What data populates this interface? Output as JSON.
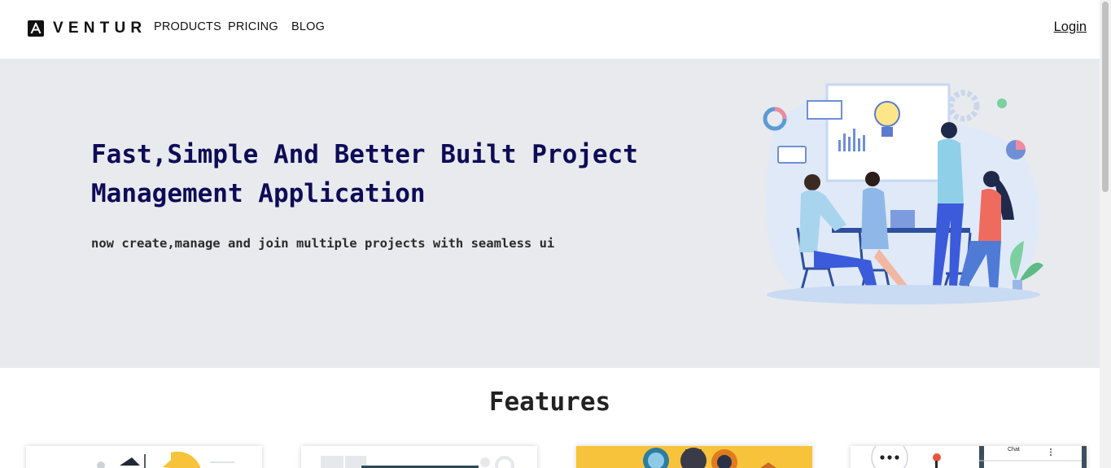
{
  "header": {
    "logo_text": "VENTUR",
    "logo_mark": "A",
    "nav": [
      "PRODUCTS",
      "PRICING",
      "BLOG"
    ],
    "login": "Login"
  },
  "hero": {
    "title": "Fast,Simple And Better Built Project Management Application",
    "subtitle": "now create,manage and join multiple projects with seamless ui",
    "illustration": "team-meeting-illustration"
  },
  "features": {
    "title": "Features",
    "cards": [
      {
        "illustration": "chart-analytics-illustration"
      },
      {
        "illustration": "dashboard-screen-illustration"
      },
      {
        "illustration": "team-avatars-illustration"
      },
      {
        "illustration": "chat-app-illustration",
        "caption": "Chat"
      }
    ]
  },
  "colors": {
    "hero_bg": "#e8eaed",
    "title_color": "#0e0b57",
    "accent_blue": "#3b5bdb",
    "card_yellow": "#f7c33a"
  }
}
